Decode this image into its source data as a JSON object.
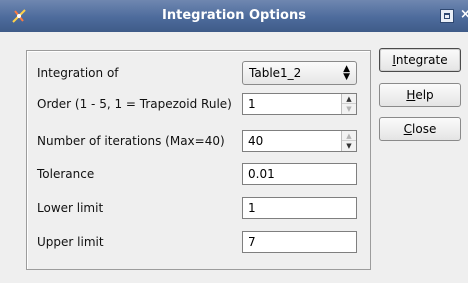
{
  "window": {
    "title": "Integration Options"
  },
  "form": {
    "integration_of": {
      "label": "Integration of",
      "value": "Table1_2"
    },
    "order": {
      "label": "Order (1 - 5, 1 = Trapezoid Rule)",
      "value": "1"
    },
    "iterations": {
      "label": "Number of iterations (Max=40)",
      "value": "40"
    },
    "tolerance": {
      "label": "Tolerance",
      "value": "0.01"
    },
    "lower_limit": {
      "label": "Lower limit",
      "value": "1"
    },
    "upper_limit": {
      "label": "Upper limit",
      "value": "7"
    }
  },
  "buttons": {
    "integrate": {
      "mnemonic": "I",
      "rest": "ntegrate"
    },
    "help": {
      "mnemonic": "H",
      "rest": "elp"
    },
    "close": {
      "mnemonic": "C",
      "rest": "lose"
    }
  },
  "icons": {
    "app": "app-icon",
    "maximize": "maximize-icon",
    "close": "close-icon"
  }
}
